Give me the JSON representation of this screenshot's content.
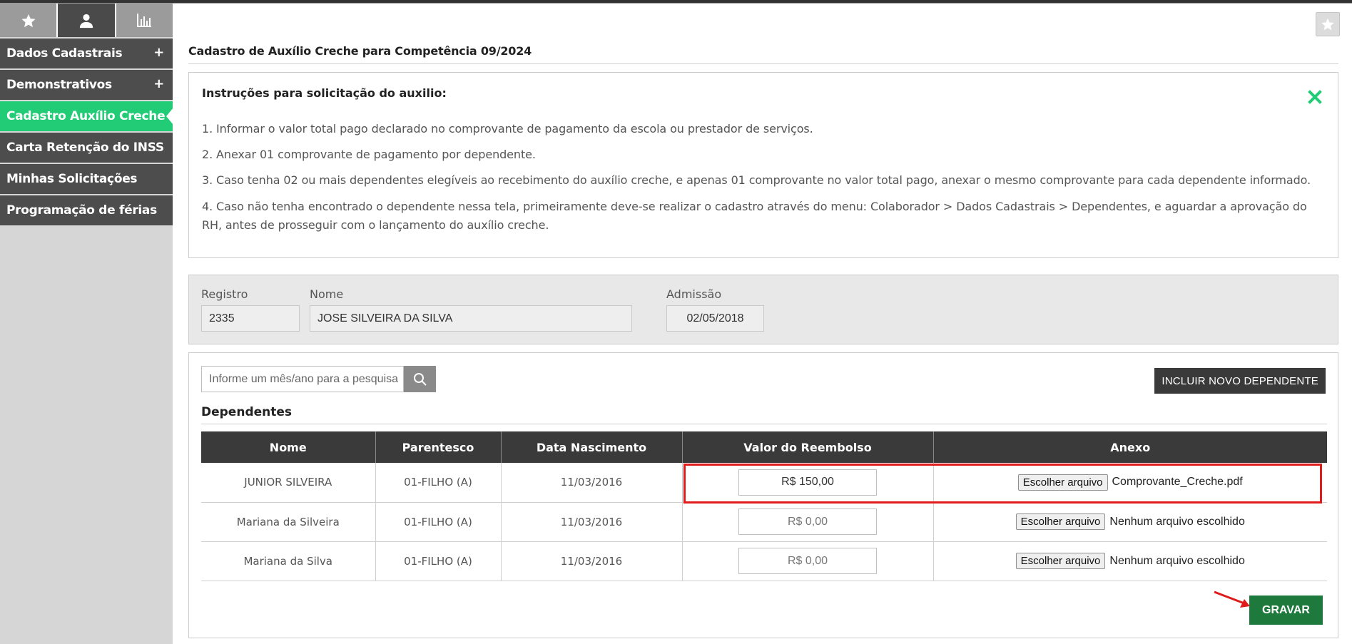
{
  "colors": {
    "accent": "#22cc77",
    "menu_bg": "#4d4d4d",
    "header_bg": "#3a3a3a",
    "save_bg": "#1e7a3c",
    "highlight": "#e01b1b"
  },
  "sidebar": {
    "tabs": [
      {
        "icon": "star-icon"
      },
      {
        "icon": "user-icon"
      },
      {
        "icon": "bar-chart-icon"
      }
    ],
    "items": [
      {
        "label": "Dados Cadastrais",
        "expand": "+"
      },
      {
        "label": "Demonstrativos",
        "expand": "+"
      },
      {
        "label": "Cadastro Auxílio Creche"
      },
      {
        "label": "Carta Retenção do INSS"
      },
      {
        "label": "Minhas Solicitações"
      },
      {
        "label": "Programação de férias"
      }
    ]
  },
  "page": {
    "title": "Cadastro de Auxílio Creche para Competência 09/2024"
  },
  "instructions": {
    "title": "Instruções para solicitação do auxilio:",
    "lines": [
      "1. Informar o valor total pago declarado no comprovante de pagamento da escola ou prestador de serviços.",
      "2. Anexar 01 comprovante de pagamento por dependente.",
      "3. Caso tenha 02 ou mais dependentes elegíveis ao recebimento do auxílio creche, e apenas 01 comprovante no valor total pago, anexar o mesmo comprovante para cada dependente informado.",
      "4. Caso não tenha encontrado o dependente nessa tela, primeiramente deve-se realizar o cadastro através do menu: Colaborador > Dados Cadastrais > Dependentes, e aguardar a aprovação do RH, antes de prosseguir com o lançamento do auxílio creche."
    ]
  },
  "employee": {
    "registro_label": "Registro",
    "registro_value": "2335",
    "nome_label": "Nome",
    "nome_value": "JOSE SILVEIRA DA SILVA",
    "admissao_label": "Admissão",
    "admissao_value": "02/05/2018"
  },
  "dependents": {
    "search_placeholder": "Informe um mês/ano para a pesquisa",
    "add_button": "INCLUIR NOVO DEPENDENTE",
    "section_title": "Dependentes",
    "columns": [
      "Nome",
      "Parentesco",
      "Data Nascimento",
      "Valor do Reembolso",
      "Anexo"
    ],
    "file_button_label": "Escolher arquivo",
    "rows": [
      {
        "nome": "JUNIOR SILVEIRA",
        "parentesco": "01-FILHO (A)",
        "nascimento": "11/03/2016",
        "valor": "R$ 150,00",
        "anexo": "Comprovante_Creche.pdf"
      },
      {
        "nome": "Mariana da Silveira",
        "parentesco": "01-FILHO (A)",
        "nascimento": "11/03/2016",
        "valor": "R$ 0,00",
        "anexo": "Nenhum arquivo escolhido"
      },
      {
        "nome": "Mariana da Silva",
        "parentesco": "01-FILHO (A)",
        "nascimento": "11/03/2016",
        "valor": "R$ 0,00",
        "anexo": "Nenhum arquivo escolhido"
      }
    ],
    "save_button": "GRAVAR"
  }
}
